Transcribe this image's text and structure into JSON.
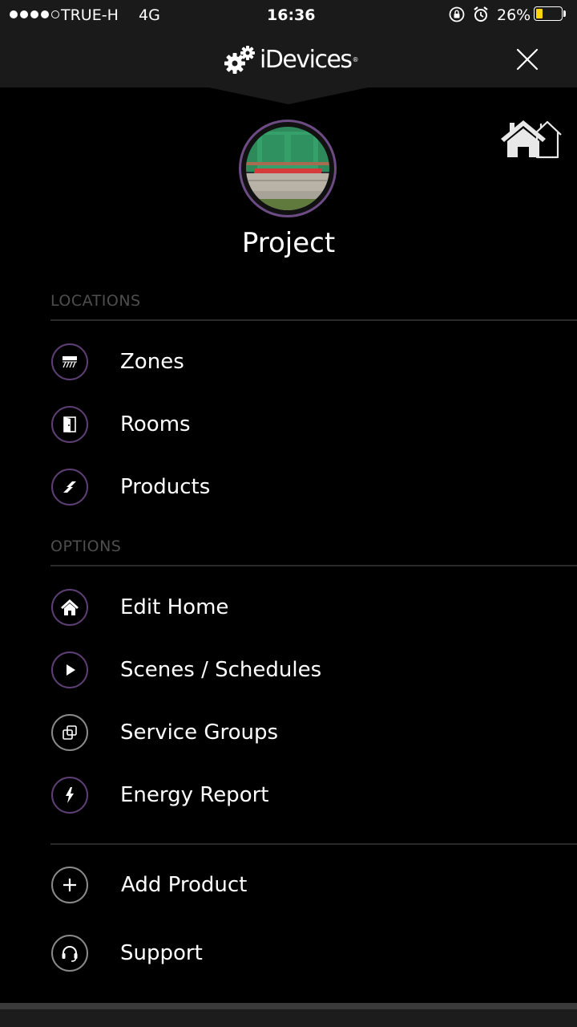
{
  "status_bar": {
    "carrier": "TRUE-H",
    "network": "4G",
    "time": "16:36",
    "battery_percent": "26%",
    "battery_level": 0.26,
    "signal_bars": 4
  },
  "header": {
    "brand": "iDevices",
    "close_icon": "close-icon"
  },
  "profile": {
    "name": "Project"
  },
  "sections": {
    "locations_label": "LOCATIONS",
    "options_label": "OPTIONS"
  },
  "locations": [
    {
      "label": "Zones",
      "icon": "zones-icon"
    },
    {
      "label": "Rooms",
      "icon": "door-icon"
    },
    {
      "label": "Products",
      "icon": "plug-icon"
    }
  ],
  "options": [
    {
      "label": "Edit Home",
      "icon": "home-icon"
    },
    {
      "label": "Scenes / Schedules",
      "icon": "play-icon"
    },
    {
      "label": "Service Groups",
      "icon": "groups-icon"
    },
    {
      "label": "Energy Report",
      "icon": "lightning-icon"
    }
  ],
  "actions": [
    {
      "label": "Add Product",
      "icon": "plus-icon"
    },
    {
      "label": "Support",
      "icon": "headset-icon"
    }
  ],
  "colors": {
    "accent": "#6d4b84",
    "battery": "#ffd60a",
    "section_label": "#4e4e4e"
  }
}
